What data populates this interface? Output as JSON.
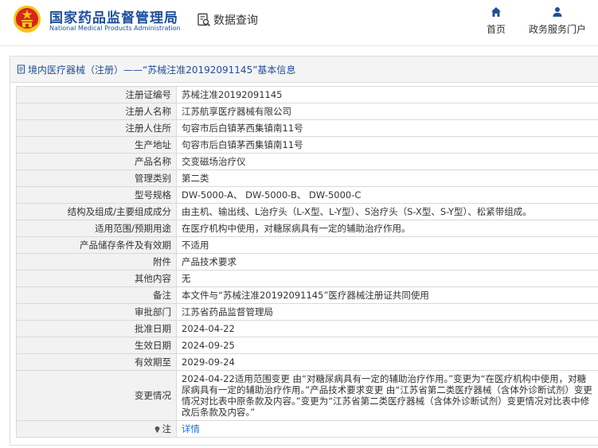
{
  "header": {
    "brand_cn": "国家药品监督管理局",
    "brand_en": "National Medical Products Administration",
    "query_title": "数据查询",
    "nav": {
      "home": "首页",
      "gov": "政务服务门户"
    },
    "icons": {
      "emblem": "national-emblem-icon",
      "query": "data-query-icon",
      "home": "home-icon",
      "gov": "user-icon"
    },
    "colors": {
      "brand": "#1d4f9c",
      "emblem_red": "#d7261e",
      "emblem_gold": "#f5c518",
      "link": "#1d6fd6"
    }
  },
  "panel": {
    "title": "境内医疗器械（注册）——“苏械注准20192091145”基本信息",
    "title_icon": "document-icon",
    "rows": [
      {
        "label": "注册证编号",
        "value": "苏械注准20192091145"
      },
      {
        "label": "注册人名称",
        "value": "江苏航享医疗器械有限公司"
      },
      {
        "label": "注册人住所",
        "value": "句容市后白镇茅西集镇南11号"
      },
      {
        "label": "生产地址",
        "value": "句容市后白镇茅西集镇南11号"
      },
      {
        "label": "产品名称",
        "value": "交变磁场治疗仪"
      },
      {
        "label": "管理类别",
        "value": "第二类"
      },
      {
        "label": "型号规格",
        "value": "DW-5000-A、 DW-5000-B、 DW-5000-C"
      },
      {
        "label": "结构及组成/主要组成成分",
        "value": "由主机、输出线、L治疗头（L-X型、L-Y型）、S治疗头（S-X型、S-Y型）、松紧带组成。"
      },
      {
        "label": "适用范围/预期用途",
        "value": "在医疗机构中使用，对糖尿病具有一定的辅助治疗作用。"
      },
      {
        "label": "产品储存条件及有效期",
        "value": "不适用"
      },
      {
        "label": "附件",
        "value": "产品技术要求"
      },
      {
        "label": "其他内容",
        "value": "无"
      },
      {
        "label": "备注",
        "value": "本文件与“苏械注准20192091145”医疗器械注册证共同使用"
      },
      {
        "label": "审批部门",
        "value": "江苏省药品监督管理局"
      },
      {
        "label": "批准日期",
        "value": "2024-04-22"
      },
      {
        "label": "生效日期",
        "value": "2024-09-25"
      },
      {
        "label": "有效期至",
        "value": "2029-09-24"
      }
    ],
    "change": {
      "label": "变更情况",
      "value": "2024-04-22适用范围变更 由“对糖尿病具有一定的辅助治疗作用。”变更为“在医疗机构中使用，对糖尿病具有一定的辅助治疗作用。”产品技术要求变更 由“江苏省第二类医疗器械（含体外诊断试剂）变更情况对比表中原条款及内容。”变更为“江苏省第二类医疗器械（含体外诊断试剂）变更情况对比表中修改后条款及内容。”"
    },
    "note": {
      "label": "注",
      "icon": "bulb-icon",
      "link": "详情"
    }
  }
}
